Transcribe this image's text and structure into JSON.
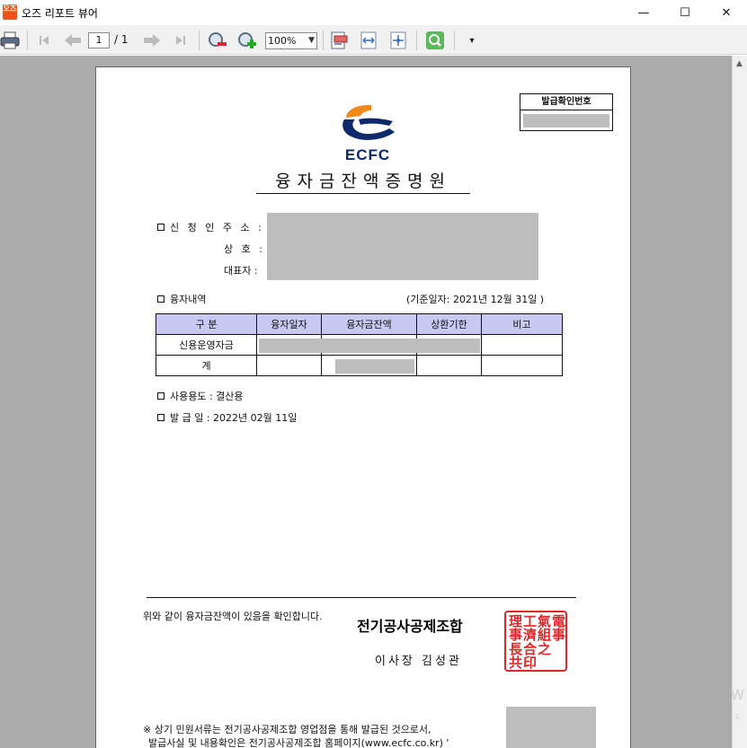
{
  "window": {
    "app_icon_text": "오즈",
    "title": "오즈 리포트 뷰어",
    "minimize_glyph": "—",
    "maximize_glyph": "☐",
    "close_glyph": "✕"
  },
  "toolbar": {
    "print_icon": "printer-icon",
    "first_icon": "first-page-icon",
    "prev_icon": "prev-page-icon",
    "current_page": "1",
    "page_total": "/ 1",
    "next_icon": "next-page-icon",
    "last_icon": "last-page-icon",
    "zoom_out_icon": "zoom-out-icon",
    "zoom_in_icon": "zoom-in-icon",
    "zoom_value": "100%",
    "more_glyph": "▾"
  },
  "document": {
    "issue_number_label": "발급확인번호",
    "logo_text": "ECFC",
    "title": "융자금잔액증명원",
    "applicant_address_label": "신 청 인 주 소 :",
    "company_label": "상 호 :",
    "ceo_label": "대표자 :",
    "loan_details_label": "융자내역",
    "base_date_label": "(기준일자: 2021년 12월 31일 )",
    "table": {
      "headers": [
        "구 분",
        "융자일자",
        "융자금잔액",
        "상환기한",
        "비고"
      ],
      "rows": [
        [
          "신용운영자금",
          "",
          "",
          "",
          ""
        ],
        [
          "계",
          "",
          "",
          "",
          ""
        ]
      ]
    },
    "usage_label": "사용용도 : 결산용",
    "issue_date_label": "발 급 일 : 2022년 02월 11일",
    "confirm_text": "위와 같이 융자금잔액이 있음을 확인합니다.",
    "organization": "전기공사공제조합",
    "ceo_signature": "이사장 김성관",
    "seal_chars": [
      "電",
      "氣",
      "工",
      "事",
      "共",
      "濟",
      "組",
      "合",
      "理",
      "事",
      "長",
      "之",
      "印"
    ],
    "note_line1": "※ 상기 민원서류는 전기공사공제조합 영업점을 통해 발급된 것으로서,",
    "note_line2": "발급사실 및 내용확인은 전기공사공제조합 홈페이지(www.ecfc.co.kr) '"
  },
  "colors": {
    "accent_logo": "#0e2a6b",
    "logo_orange": "#f08a1c",
    "table_header": "#c8c8f2",
    "seal_red": "#d92a2a",
    "viewer_bg": "#ababab"
  }
}
